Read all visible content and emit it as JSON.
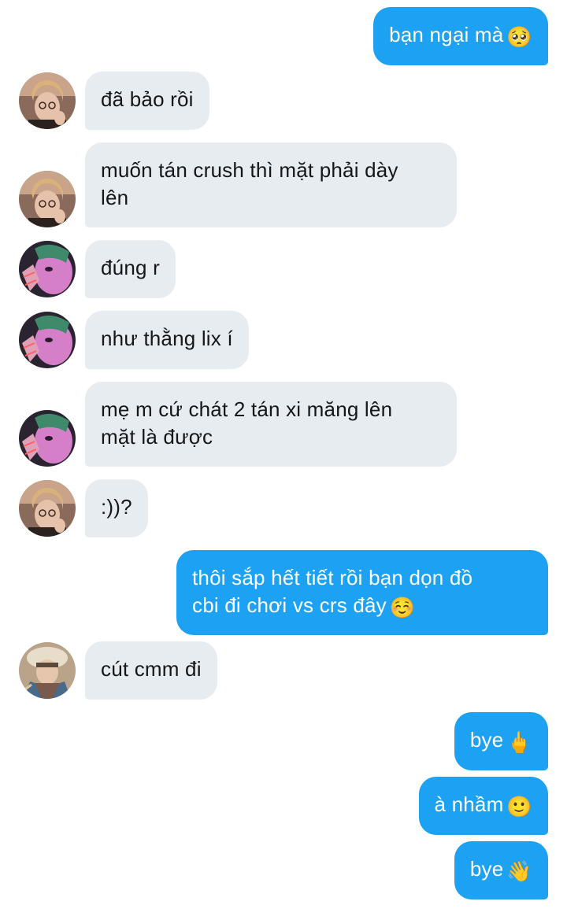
{
  "messages": [
    {
      "from": "me",
      "text": "bạn ngại mà",
      "emoji": "🥺"
    },
    {
      "from": "user-a",
      "text": "đã bảo rồi"
    },
    {
      "from": "user-a",
      "line1": "muốn tán crush thì mặt phải dày",
      "line2": "lên"
    },
    {
      "from": "user-b",
      "text": "đúng r"
    },
    {
      "from": "user-b",
      "text": "như thằng lix í"
    },
    {
      "from": "user-b",
      "line1": "mẹ m cứ chát 2 tán xi măng lên",
      "line2": "mặt là được"
    },
    {
      "from": "user-a",
      "text": ":))?"
    },
    {
      "from": "me",
      "line1": "thôi sắp hết tiết rồi bạn dọn đồ",
      "line2": "cbi đi chơi vs crs đây",
      "emoji": "☺️"
    },
    {
      "from": "user-c",
      "text": "cút cmm đi"
    },
    {
      "from": "me",
      "text": "bye",
      "emoji": "🖕"
    },
    {
      "from": "me",
      "text": "à nhầm",
      "emoji": "🙂"
    },
    {
      "from": "me",
      "text": "bye",
      "emoji": "👋"
    }
  ],
  "colors": {
    "outgoing_bubble": "#1da1f2",
    "incoming_bubble": "#e6ecf0",
    "outgoing_text": "#ffffff",
    "incoming_text": "#14171a"
  },
  "avatars": {
    "user-a": "avatar-photo-girl-glasses",
    "user-b": "avatar-photo-green-hair-pink",
    "user-c": "avatar-photo-hat-jacket"
  }
}
